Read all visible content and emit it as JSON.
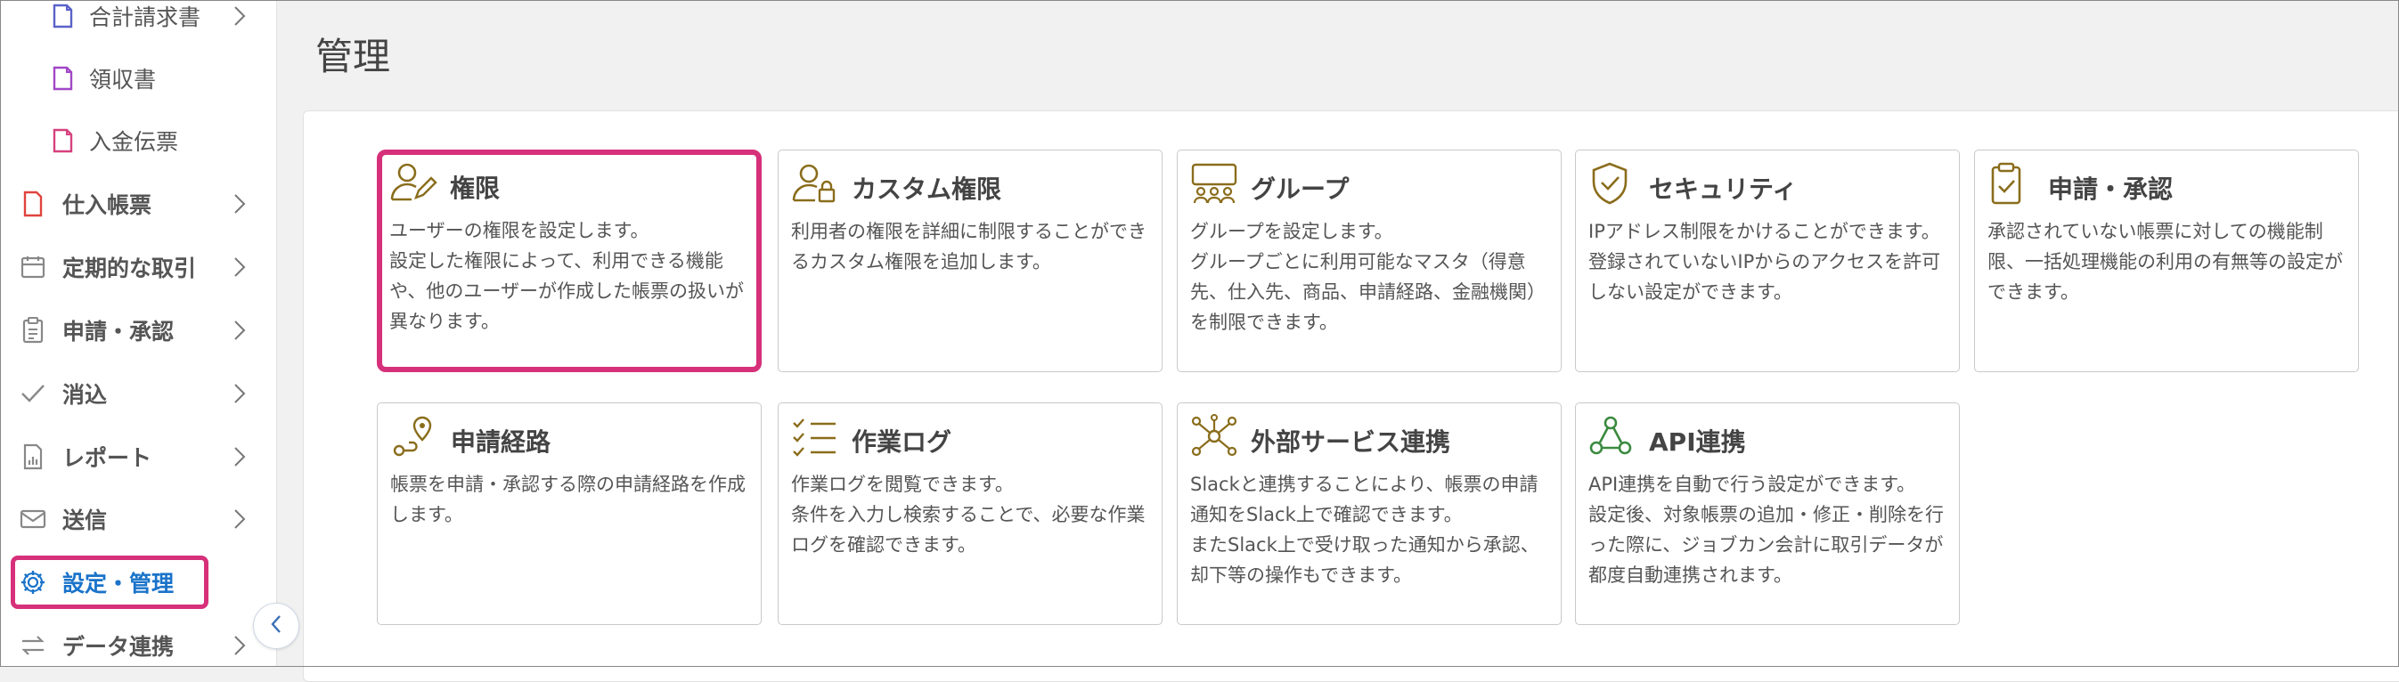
{
  "sidebar": {
    "items": [
      {
        "label": "合計請求書",
        "icon": "document-icon"
      },
      {
        "label": "領収書",
        "icon": "document-icon"
      },
      {
        "label": "入金伝票",
        "icon": "document-icon"
      },
      {
        "label": "仕入帳票",
        "icon": "file-icon"
      },
      {
        "label": "定期的な取引",
        "icon": "calendar-icon"
      },
      {
        "label": "申請・承認",
        "icon": "clipboard-icon"
      },
      {
        "label": "消込",
        "icon": "check-icon"
      },
      {
        "label": "レポート",
        "icon": "report-icon"
      },
      {
        "label": "送信",
        "icon": "mail-icon"
      },
      {
        "label": "設定・管理",
        "icon": "gear-icon"
      },
      {
        "label": "データ連携",
        "icon": "sync-icon"
      }
    ]
  },
  "page": {
    "title": "管理"
  },
  "cards": [
    {
      "title": "権限",
      "icon": "user-edit-icon",
      "desc": [
        "ユーザーの権限を設定します。",
        "設定した権限によって、利用できる機能や、他のユーザーが作成した帳票の扱いが異なります。"
      ]
    },
    {
      "title": "カスタム権限",
      "icon": "user-lock-icon",
      "desc": [
        "利用者の権限を詳細に制限することができるカスタム権限を追加します。"
      ]
    },
    {
      "title": "グループ",
      "icon": "group-icon",
      "desc": [
        "グループを設定します。",
        "グループごとに利用可能なマスタ（得意先、仕入先、商品、申請経路、金融機関）を制限できます。"
      ]
    },
    {
      "title": "セキュリティ",
      "icon": "shield-icon",
      "desc": [
        "IPアドレス制限をかけることができます。",
        "登録されていないIPからのアクセスを許可しない設定ができます。"
      ]
    },
    {
      "title": "申請・承認",
      "icon": "clipboard-check-icon",
      "desc": [
        "承認されていない帳票に対しての機能制限、一括処理機能の利用の有無等の設定ができます。"
      ]
    },
    {
      "title": "申請経路",
      "icon": "route-icon",
      "desc": [
        "帳票を申請・承認する際の申請経路を作成します。"
      ]
    },
    {
      "title": "作業ログ",
      "icon": "checklist-icon",
      "desc": [
        "作業ログを閲覧できます。",
        "条件を入力し検索することで、必要な作業ログを確認できます。"
      ]
    },
    {
      "title": "外部サービス連携",
      "icon": "network-icon",
      "desc": [
        "Slackと連携することにより、帳票の申請通知をSlack上で確認できます。",
        "またSlack上で受け取った通知から承認、却下等の操作もできます。"
      ]
    },
    {
      "title": "API連携",
      "icon": "api-icon",
      "desc": [
        "API連携を自動で行う設定ができます。",
        "設定後、対象帳票の追加・修正・削除を行った際に、ジョブカン会計に取引データが都度自動連携されます。"
      ]
    }
  ],
  "colors": {
    "accent": "#d6307a",
    "active_text": "#1a73c9",
    "icon_gold": "#8a6d1c",
    "icon_green": "#3a8a3f"
  }
}
